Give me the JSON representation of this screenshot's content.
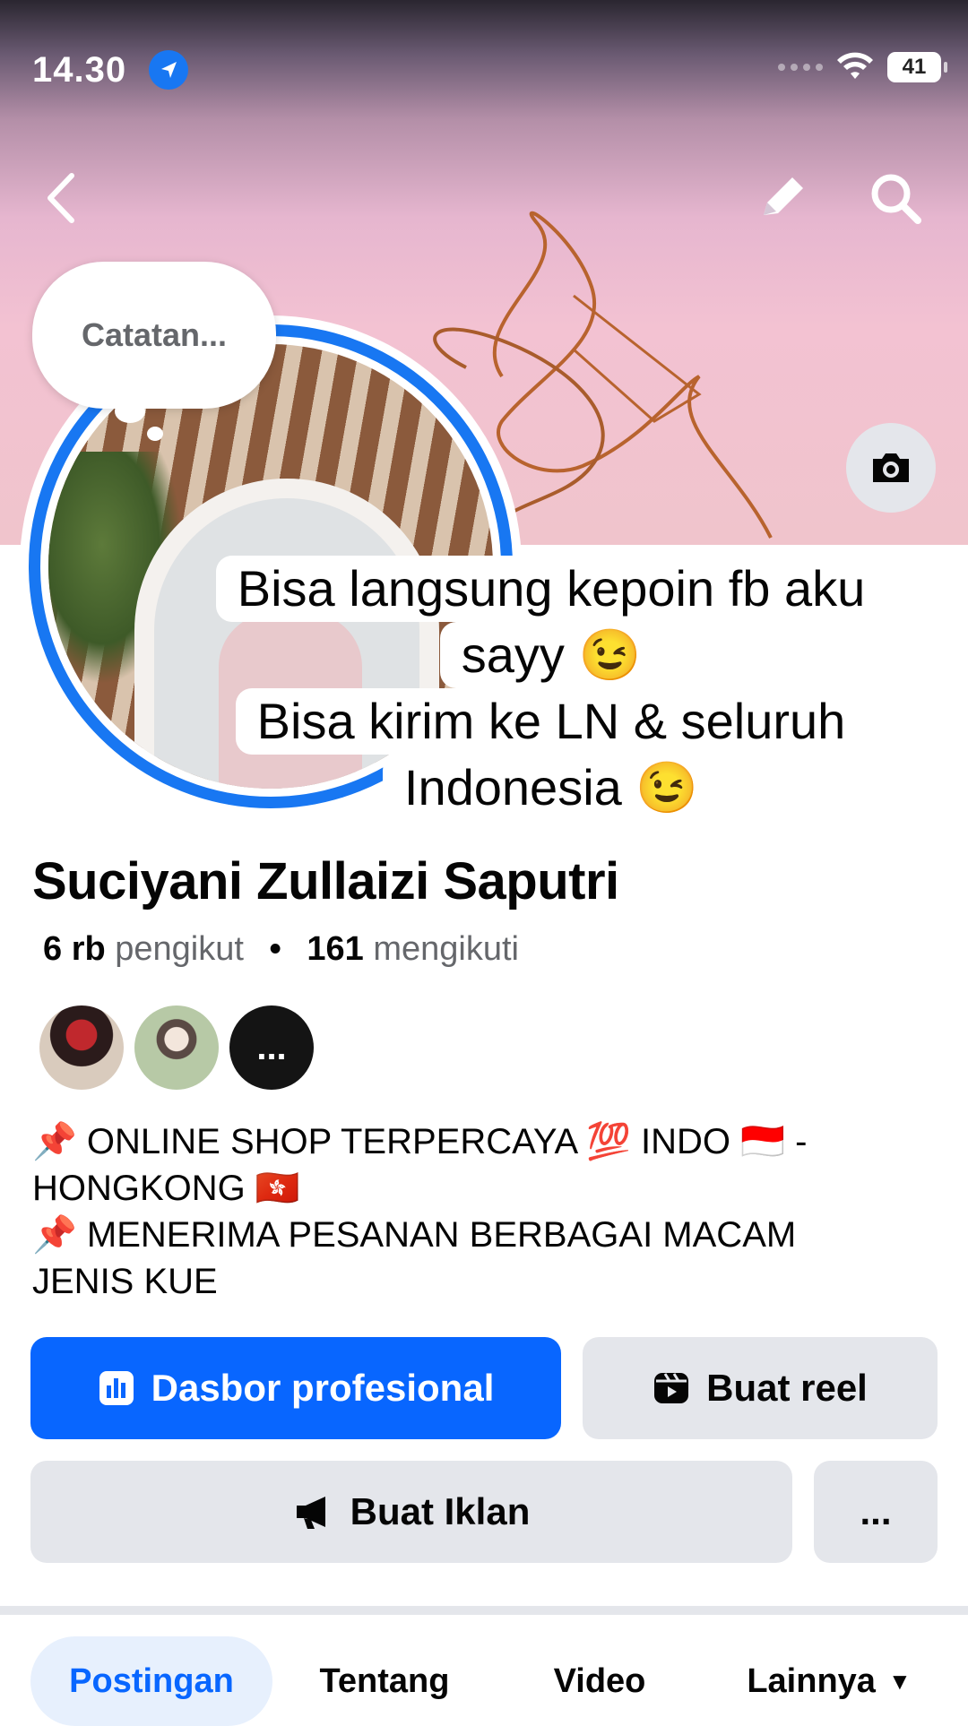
{
  "status_bar": {
    "time": "14.30",
    "battery": "41"
  },
  "note": {
    "placeholder": "Catatan..."
  },
  "overlay_caption": [
    "Bisa langsung kepoin fb aku",
    "sayy 😉",
    "Bisa kirim ke LN & seluruh",
    "Indonesia 😉"
  ],
  "profile": {
    "name": "Suciyani Zullaizi Saputri",
    "followers_count": "6 rb",
    "followers_label": "pengikut",
    "following_count": "161",
    "following_label": "mengikuti",
    "friends_more": "..."
  },
  "bio": [
    "📌 ONLINE SHOP TERPERCAYA 💯  INDO 🇮🇩 -",
    "HONGKONG 🇭🇰",
    "📌 MENERIMA PESANAN BERBAGAI MACAM",
    "JENIS KUE"
  ],
  "actions": {
    "dashboard": "Dasbor profesional",
    "reel": "Buat reel",
    "ads": "Buat Iklan",
    "more": "..."
  },
  "tabs": [
    {
      "label": "Postingan"
    },
    {
      "label": "Tentang"
    },
    {
      "label": "Video"
    },
    {
      "label": "Lainnya"
    }
  ],
  "colors": {
    "accent": "#0866ff",
    "ring": "#1877f2",
    "button_gray": "#e4e6eb",
    "muted_text": "#65676b"
  },
  "icons": [
    "location-arrow-icon",
    "wifi-icon",
    "battery-icon",
    "back-icon",
    "edit-icon",
    "search-icon",
    "camera-icon",
    "dashboard-icon",
    "reel-icon",
    "megaphone-icon",
    "more-icon",
    "caret-down-icon"
  ]
}
